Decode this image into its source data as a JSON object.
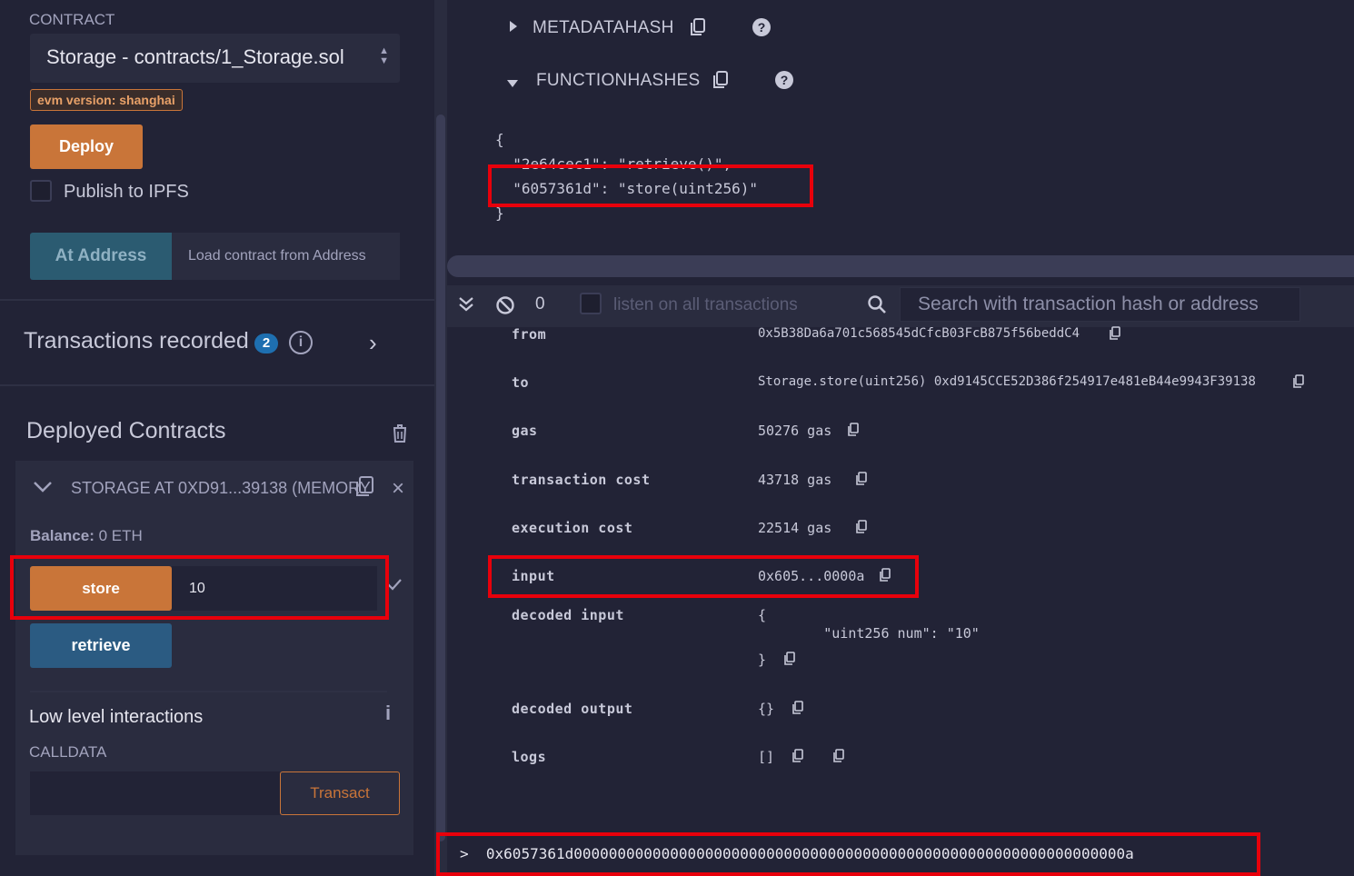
{
  "left": {
    "contract_label": "CONTRACT",
    "contract_selected": "Storage - contracts/1_Storage.sol",
    "evm_badge": "evm version: shanghai",
    "deploy_label": "Deploy",
    "publish_label": "Publish to IPFS",
    "at_address_label": "At Address",
    "at_address_placeholder": "Load contract from Address",
    "tx_recorded_label": "Transactions recorded",
    "tx_recorded_count": "2",
    "deployed_title": "Deployed Contracts",
    "instance_name": "STORAGE AT 0XD91...39138 (MEMORY",
    "balance_label": "Balance:",
    "balance_value": "0 ETH",
    "store_label": "store",
    "store_value": "10",
    "retrieve_label": "retrieve",
    "low_level_label": "Low level interactions",
    "calldata_label": "CALLDATA",
    "transact_label": "Transact"
  },
  "compile": {
    "metadatahash_label": "METADATAHASH",
    "functionhashes_label": "FUNCTIONHASHES",
    "json_open": "{",
    "hash_line_1": "  \"2e64cec1\": \"retrieve()\",",
    "hash_line_2": "  \"6057361d\": \"store(uint256)\"",
    "json_close": "}"
  },
  "terminal": {
    "pending_count": "0",
    "listen_label": "listen on all transactions",
    "search_placeholder": "Search with transaction hash or address",
    "rows": {
      "from_key": "from",
      "from_val": "0x5B38Da6a701c568545dCfcB03FcB875f56beddC4",
      "to_key": "to",
      "to_val": "Storage.store(uint256) 0xd9145CCE52D386f254917e481eB44e9943F39138",
      "gas_key": "gas",
      "gas_val": "50276 gas",
      "tx_cost_key": "transaction cost",
      "tx_cost_val": "43718 gas",
      "exec_cost_key": "execution cost",
      "exec_cost_val": "22514 gas",
      "input_key": "input",
      "input_val": "0x605...0000a",
      "decoded_input_key": "decoded input",
      "decoded_input_open": "{",
      "decoded_input_line": "        \"uint256 num\": \"10\"",
      "decoded_input_close": "}",
      "decoded_output_key": "decoded output",
      "decoded_output_val": "{}",
      "logs_key": "logs",
      "logs_val": "[]"
    },
    "prompt": ">",
    "calldata_line": "0x6057361d000000000000000000000000000000000000000000000000000000000000000a"
  }
}
